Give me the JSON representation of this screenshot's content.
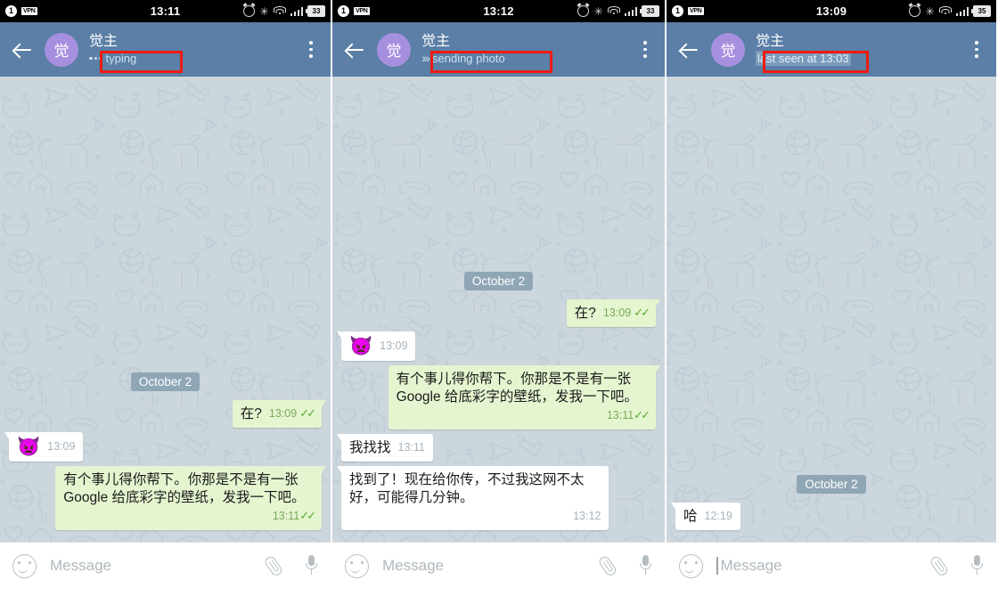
{
  "app": {
    "contact_name": "觉主",
    "avatar_initial": "觉",
    "avatar_color": "#a78fe0",
    "header_color": "#5b7fa6",
    "accent_out_bubble": "#e5f5d0",
    "annotation_color": "#ee1b11"
  },
  "input_bar": {
    "placeholder": "Message",
    "emoji_icon": "smiley-icon",
    "attach_icon": "paperclip-icon",
    "voice_icon": "microphone-icon"
  },
  "status_icons": {
    "sim_badge": "1",
    "vpn_badge": "VPN",
    "alarm": "alarm-icon",
    "bluetooth": "✳",
    "wifi": "wifi-icon",
    "signal": "signal-icon"
  },
  "panels": [
    {
      "id": "panel-typing",
      "status_bar": {
        "time": "13:11",
        "battery": "33"
      },
      "header": {
        "title": "觉主",
        "subtitle": "typing",
        "subtitle_kind": "typing",
        "subtitle_highlighted": false,
        "annotated": true
      },
      "input_cursor": false,
      "messages": [
        {
          "kind": "date",
          "text": "October 2"
        },
        {
          "kind": "text",
          "side": "out",
          "text": "在?",
          "time": "13:09",
          "ticks": true,
          "layout": "inline"
        },
        {
          "kind": "emoji",
          "side": "in",
          "text": "👿",
          "time": "13:09",
          "ticks": false,
          "layout": "inline"
        },
        {
          "kind": "text",
          "side": "out",
          "text": "有个事儿得你帮下。你那是不是有一张 Google 给底彩字的壁纸，发我一下吧。",
          "time": "13:11",
          "ticks": true,
          "layout": "block"
        }
      ]
    },
    {
      "id": "panel-sending-photo",
      "status_bar": {
        "time": "13:12",
        "battery": "33"
      },
      "header": {
        "title": "觉主",
        "subtitle": "sending photo",
        "subtitle_kind": "sending",
        "subtitle_highlighted": false,
        "annotated": true
      },
      "input_cursor": false,
      "messages": [
        {
          "kind": "date",
          "text": "October 2"
        },
        {
          "kind": "text",
          "side": "out",
          "text": "在?",
          "time": "13:09",
          "ticks": true,
          "layout": "inline"
        },
        {
          "kind": "emoji",
          "side": "in",
          "text": "👿",
          "time": "13:09",
          "ticks": false,
          "layout": "inline"
        },
        {
          "kind": "text",
          "side": "out",
          "text": "有个事儿得你帮下。你那是不是有一张 Google 给底彩字的壁纸，发我一下吧。",
          "time": "13:11",
          "ticks": true,
          "layout": "block"
        },
        {
          "kind": "text",
          "side": "in",
          "text": "我找找",
          "time": "13:11",
          "ticks": false,
          "layout": "inline"
        },
        {
          "kind": "text",
          "side": "in",
          "text": "找到了！现在给你传，不过我这网不太好，可能得几分钟。",
          "time": "13:12",
          "ticks": false,
          "layout": "block"
        }
      ]
    },
    {
      "id": "panel-last-seen",
      "status_bar": {
        "time": "13:09",
        "battery": "35"
      },
      "header": {
        "title": "觉主",
        "subtitle": "last seen at 13:03",
        "subtitle_kind": "plain",
        "subtitle_highlighted": true,
        "annotated": true
      },
      "input_cursor": true,
      "messages": [
        {
          "kind": "date",
          "text": "October 2"
        },
        {
          "kind": "text",
          "side": "in",
          "text": "哈",
          "time": "12:19",
          "ticks": false,
          "layout": "inline"
        }
      ]
    }
  ]
}
